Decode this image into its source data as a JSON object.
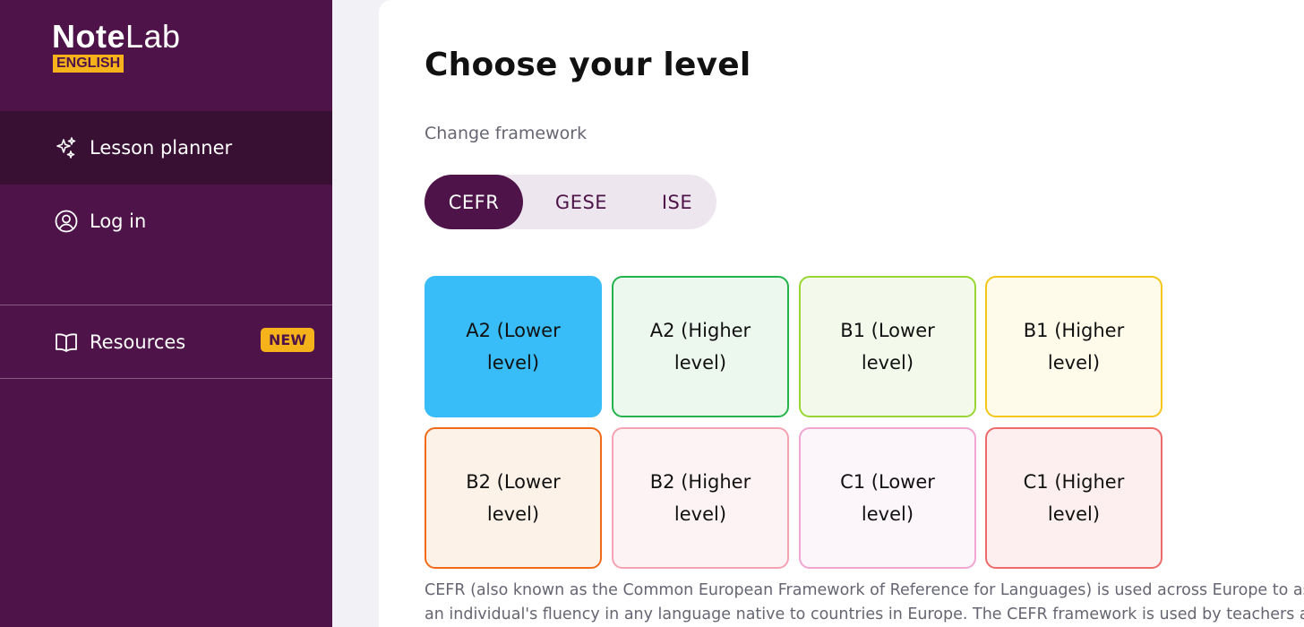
{
  "logo": {
    "bold": "Note",
    "light": "Lab",
    "badge": "ENGLISH"
  },
  "sidebar": {
    "items": [
      {
        "label": "Lesson planner",
        "icon": "sparkles-icon",
        "active": true
      },
      {
        "label": "Log in",
        "icon": "user-circle-icon"
      },
      {
        "label": "Resources",
        "icon": "book-open-icon",
        "badge": "NEW"
      }
    ]
  },
  "main": {
    "title": "Choose your level",
    "framework_label": "Change framework",
    "frameworks": [
      {
        "label": "CEFR",
        "active": true
      },
      {
        "label": "GESE"
      },
      {
        "label": "ISE"
      }
    ],
    "levels": [
      {
        "label": "A2 (Lower level)",
        "bg": "#38bdf8",
        "border": "#38bdf8",
        "selected": true
      },
      {
        "label": "A2 (Higher level)",
        "bg": "#ecf7ee",
        "border": "#22b34a"
      },
      {
        "label": "B1 (Lower level)",
        "bg": "#f3faeb",
        "border": "#9ad631"
      },
      {
        "label": "B1 (Higher level)",
        "bg": "#fffbeb",
        "border": "#f5c518"
      },
      {
        "label": "B2 (Lower level)",
        "bg": "#fdf2e8",
        "border": "#f06a1a"
      },
      {
        "label": "B2 (Higher level)",
        "bg": "#fdf3f5",
        "border": "#f5a3b3"
      },
      {
        "label": "C1 (Lower level)",
        "bg": "#fcf5fa",
        "border": "#f2a5d2"
      },
      {
        "label": "C1 (Higher level)",
        "bg": "#fdeff0",
        "border": "#ee6a6a"
      }
    ],
    "description_line1": "CEFR (also known as the Common European Framework of Reference for Languages) is used across Europe to assess",
    "description_line2": "an individual's fluency in any language native to countries in Europe. The CEFR framework is used by teachers and"
  },
  "colors": {
    "brand": "#4e1449",
    "brand_dark": "#381033",
    "accent": "#f6b21b"
  }
}
